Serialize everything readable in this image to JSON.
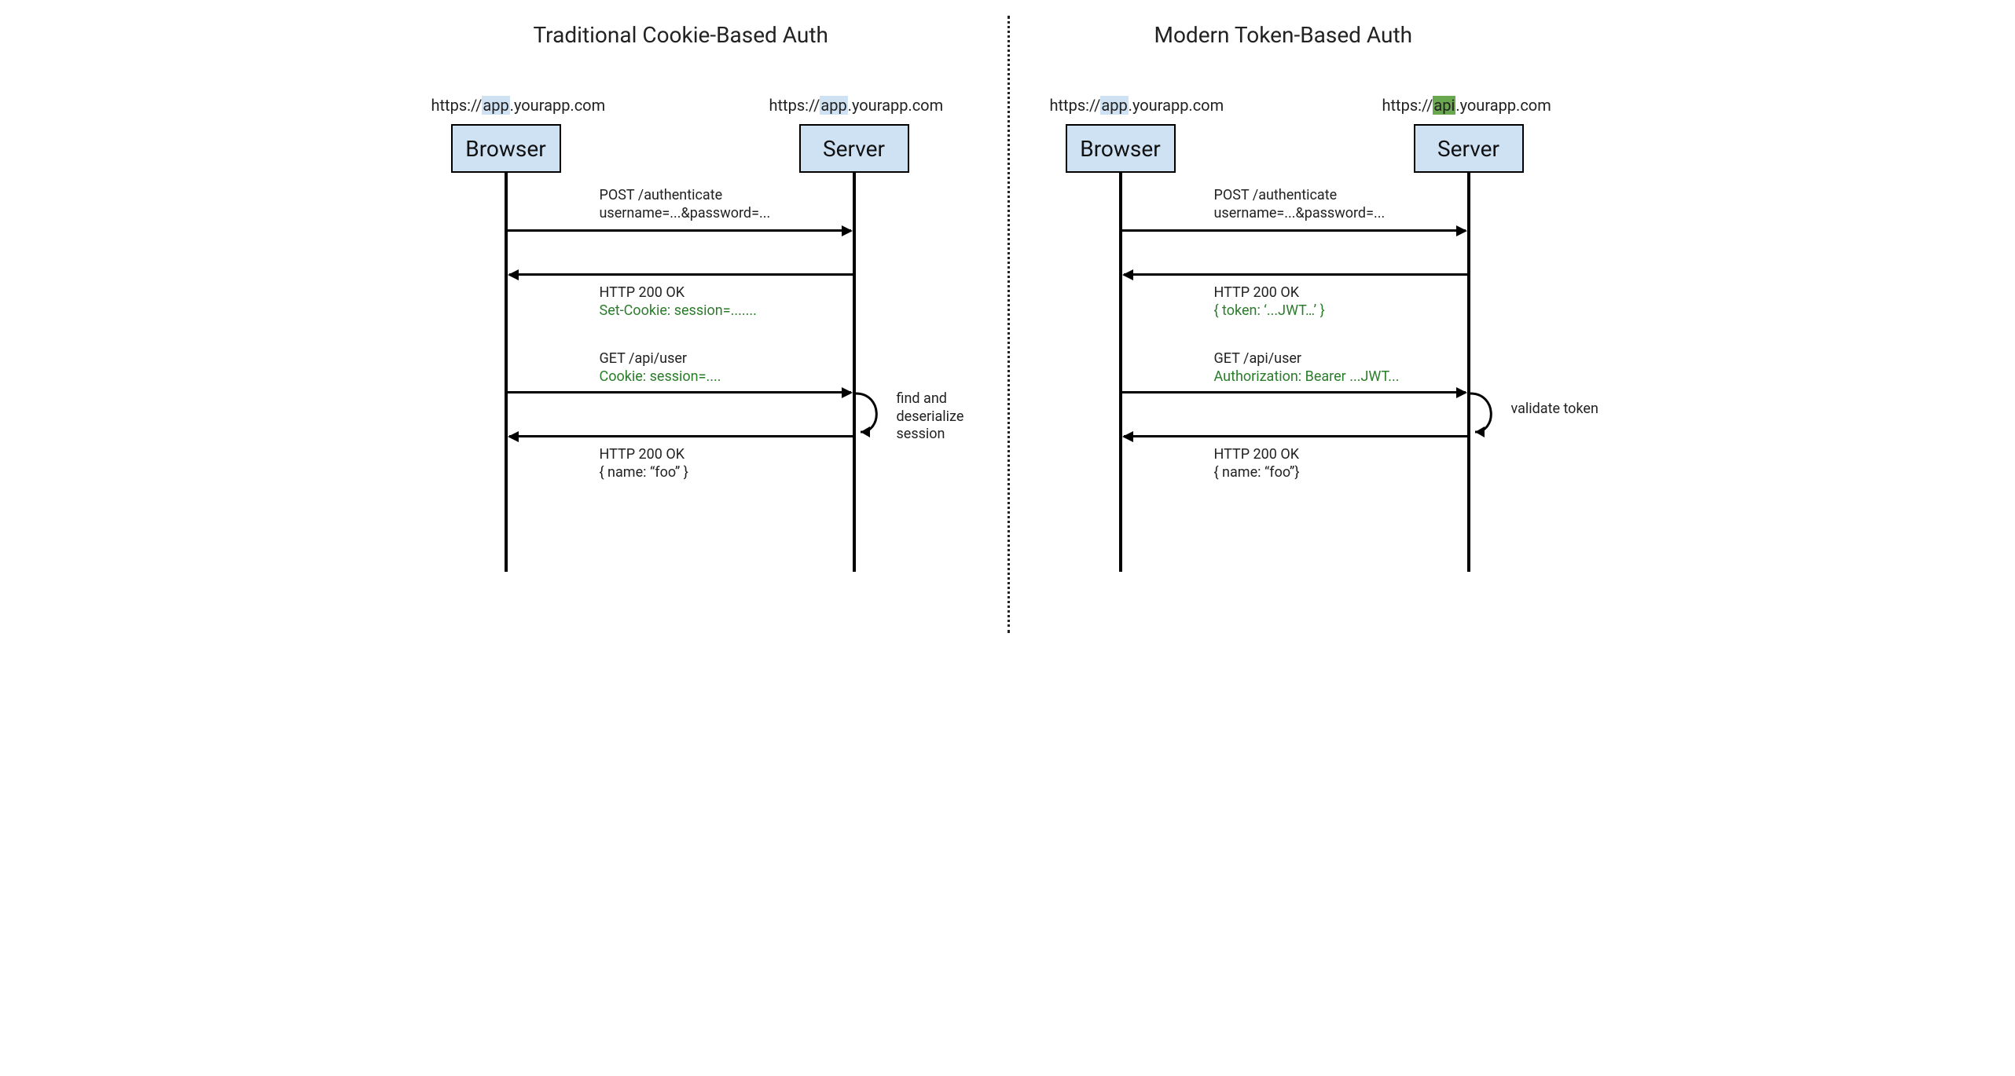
{
  "left": {
    "title": "Traditional Cookie-Based Auth",
    "browser_url_pre": "https://",
    "browser_url_hl": "app",
    "browser_url_post": ".yourapp.com",
    "server_url_pre": "https://",
    "server_url_hl": "app",
    "server_url_hl_class": "hl-app",
    "server_url_post": ".yourapp.com",
    "browser_label": "Browser",
    "server_label": "Server",
    "m1_line1": "POST /authenticate",
    "m1_line2": "username=...&password=...",
    "m2_line1": "HTTP 200 OK",
    "m2_line2": "Set-Cookie: session=.......",
    "m3_line1": "GET /api/user",
    "m3_line2": "Cookie: session=....",
    "server_note": "find and\ndeserialize\nsession",
    "m4_line1": "HTTP 200 OK",
    "m4_line2": "{  name: “foo” }"
  },
  "right": {
    "title": "Modern Token-Based Auth",
    "browser_url_pre": "https://",
    "browser_url_hl": "app",
    "browser_url_post": ".yourapp.com",
    "server_url_pre": "https://",
    "server_url_hl": "api",
    "server_url_hl_class": "hl-api",
    "server_url_post": ".yourapp.com",
    "browser_label": "Browser",
    "server_label": "Server",
    "m1_line1": "POST /authenticate",
    "m1_line2": "username=...&password=...",
    "m2_line1": "HTTP 200 OK",
    "m2_line2": "{ token: ‘...JWT…’ }",
    "m3_line1": "GET /api/user",
    "m3_line2": "Authorization: Bearer ...JWT...",
    "server_note": "validate token",
    "m4_line1": "HTTP 200 OK",
    "m4_line2": "{ name: “foo”}"
  },
  "colors": {
    "actor_fill": "#cfe2f3",
    "highlight_app": "#cfe2f3",
    "highlight_api": "#6aa84f",
    "accent_text": "#2a7d2a"
  }
}
